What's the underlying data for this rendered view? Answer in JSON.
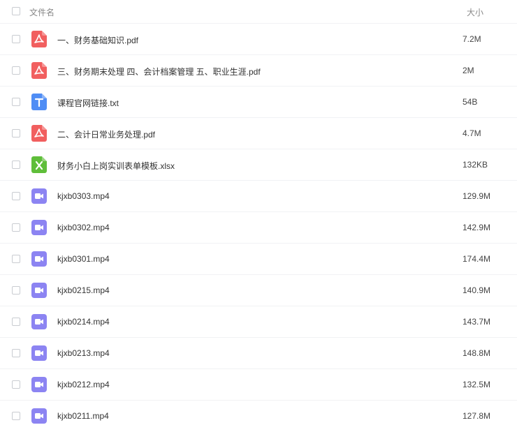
{
  "header": {
    "name_label": "文件名",
    "size_label": "大小"
  },
  "colors": {
    "pdf": "#f15f5f",
    "txt": "#4f8df5",
    "xlsx": "#5fbe3a",
    "video": "#8c84f2"
  },
  "files": [
    {
      "name": "一、财务基础知识.pdf",
      "size": "7.2M",
      "type": "pdf",
      "icon": "pdf-icon"
    },
    {
      "name": "三、财务期末处理 四、会计档案管理 五、职业生涯.pdf",
      "size": "2M",
      "type": "pdf",
      "icon": "pdf-icon"
    },
    {
      "name": "课程官网链接.txt",
      "size": "54B",
      "type": "txt",
      "icon": "txt-icon"
    },
    {
      "name": "二、会计日常业务处理.pdf",
      "size": "4.7M",
      "type": "pdf",
      "icon": "pdf-icon"
    },
    {
      "name": "财务小白上岗实训表单模板.xlsx",
      "size": "132KB",
      "type": "xlsx",
      "icon": "xlsx-icon"
    },
    {
      "name": "kjxb0303.mp4",
      "size": "129.9M",
      "type": "video",
      "icon": "video-icon"
    },
    {
      "name": "kjxb0302.mp4",
      "size": "142.9M",
      "type": "video",
      "icon": "video-icon"
    },
    {
      "name": "kjxb0301.mp4",
      "size": "174.4M",
      "type": "video",
      "icon": "video-icon"
    },
    {
      "name": "kjxb0215.mp4",
      "size": "140.9M",
      "type": "video",
      "icon": "video-icon"
    },
    {
      "name": "kjxb0214.mp4",
      "size": "143.7M",
      "type": "video",
      "icon": "video-icon"
    },
    {
      "name": "kjxb0213.mp4",
      "size": "148.8M",
      "type": "video",
      "icon": "video-icon"
    },
    {
      "name": "kjxb0212.mp4",
      "size": "132.5M",
      "type": "video",
      "icon": "video-icon"
    },
    {
      "name": "kjxb0211.mp4",
      "size": "127.8M",
      "type": "video",
      "icon": "video-icon"
    }
  ]
}
